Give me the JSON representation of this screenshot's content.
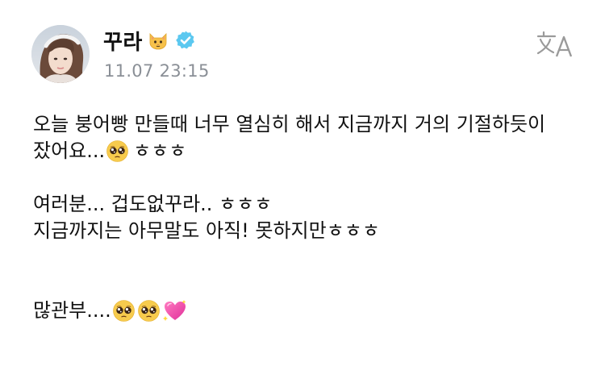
{
  "author": {
    "name": "꾸라",
    "name_emoji": "cat-face-emoji",
    "verified": true,
    "timestamp": "11.07 23:15"
  },
  "actions": {
    "translate_icon": "translate-icon"
  },
  "post": {
    "line1": "오늘 붕어빵 만들때 너무 열심히 해서 지금까지 거의 기절하듯이",
    "line2_text": "잤어요...",
    "line2_tail": "ㅎㅎㅎ",
    "line3": "여러분... 겁도없꾸라.. ㅎㅎㅎ",
    "line4": "지금까지는 아무말도 아직! 못하지만ㅎㅎㅎ",
    "line5_text": "많관부....",
    "emojis": [
      "pleading-face-emoji",
      "pleading-face-emoji",
      "pleading-face-emoji",
      "sparkling-heart-emoji"
    ]
  },
  "colors": {
    "verified_badge": "#5bc8f0",
    "timestamp": "#8a8f96",
    "text": "#111111",
    "translate_icon": "#9a9a9a"
  }
}
